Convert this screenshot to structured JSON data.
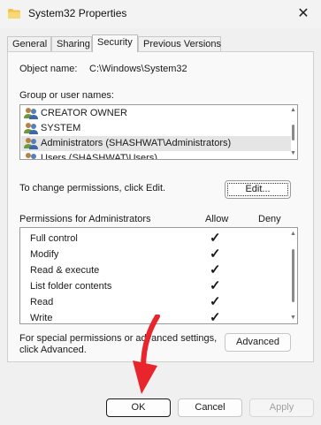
{
  "window": {
    "title": "System32 Properties",
    "close_glyph": "✕"
  },
  "tabs": [
    {
      "label": "General"
    },
    {
      "label": "Sharing"
    },
    {
      "label": "Security",
      "active": true
    },
    {
      "label": "Previous Versions"
    }
  ],
  "object": {
    "label": "Object name:",
    "value": "C:\\Windows\\System32"
  },
  "groups": {
    "label": "Group or user names:",
    "items": [
      {
        "label": "CREATOR OWNER"
      },
      {
        "label": "SYSTEM"
      },
      {
        "label": "Administrators (SHASHWAT\\Administrators)",
        "selected": true
      },
      {
        "label": "Users (SHASHWAT\\Users)"
      }
    ]
  },
  "change_perms": {
    "text": "To change permissions, click Edit.",
    "edit_label": "Edit..."
  },
  "permissions": {
    "header": "Permissions for Administrators",
    "allow_header": "Allow",
    "deny_header": "Deny",
    "rows": [
      {
        "name": "Full control",
        "allow": "✓"
      },
      {
        "name": "Modify",
        "allow": "✓"
      },
      {
        "name": "Read & execute",
        "allow": "✓"
      },
      {
        "name": "List folder contents",
        "allow": "✓"
      },
      {
        "name": "Read",
        "allow": "✓"
      },
      {
        "name": "Write",
        "allow": "✓"
      }
    ]
  },
  "special": {
    "line1": "For special permissions or advanced settings,",
    "line2": "click Advanced.",
    "advanced_label": "Advanced"
  },
  "footer": {
    "ok_label": "OK",
    "cancel_label": "Cancel",
    "apply_label": "Apply"
  },
  "colors": {
    "accent_arrow": "#e8242c",
    "selection": "#e5e5e5"
  }
}
